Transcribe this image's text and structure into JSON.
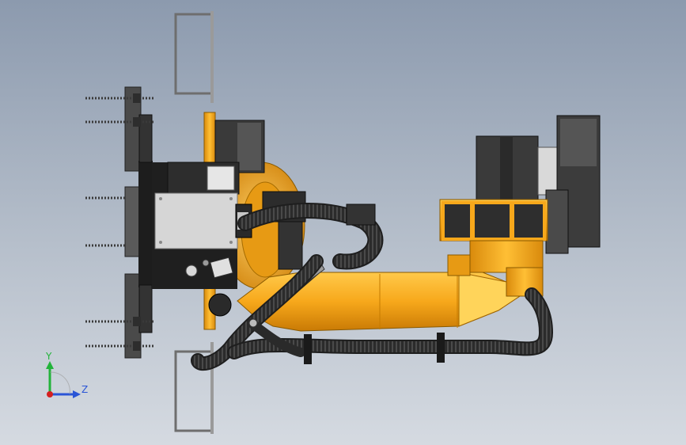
{
  "viewport": {
    "background_top": "#8c9aae",
    "background_bottom": "#d5dae1"
  },
  "model": {
    "primary_color": "#f7a81b",
    "dark_color": "#3b3b3b",
    "hose_color": "#2e2e2e",
    "panel_color": "#d9d9d9"
  },
  "triad": {
    "y_label": "Y",
    "z_label": "Z",
    "y_color": "#22b33a",
    "z_color": "#2a55d6",
    "x_color": "#d42020"
  }
}
